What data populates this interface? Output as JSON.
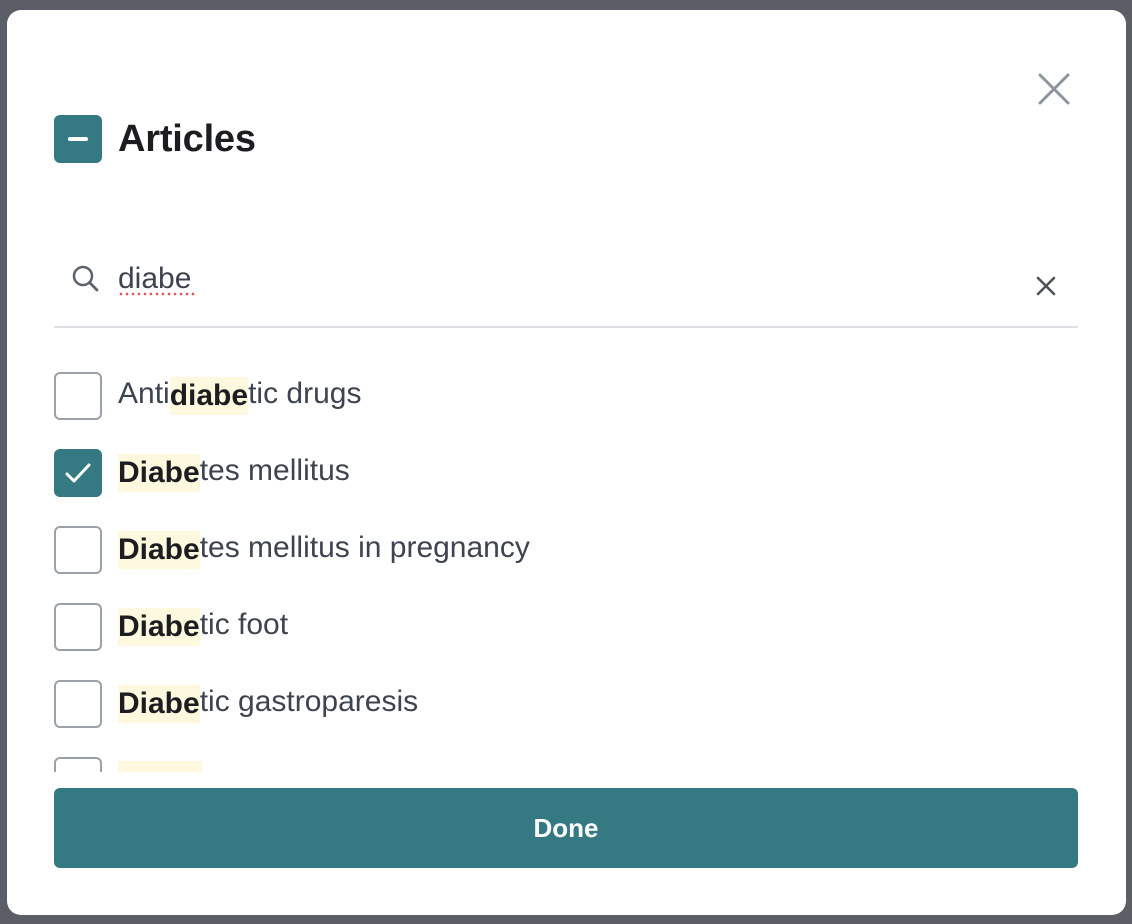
{
  "dialog": {
    "title": "Articles",
    "close_icon": "close-icon"
  },
  "search": {
    "value": "diabe",
    "icon": "search-icon",
    "clear_icon": "clear-icon"
  },
  "items": [
    {
      "before": "Anti",
      "match": "diabe",
      "after": "tic drugs",
      "checked": false
    },
    {
      "before": "",
      "match": "Diabe",
      "after": "tes mellitus",
      "checked": true
    },
    {
      "before": "",
      "match": "Diabe",
      "after": "tes mellitus in pregnancy",
      "checked": false
    },
    {
      "before": "",
      "match": "Diabe",
      "after": "tic foot",
      "checked": false
    },
    {
      "before": "",
      "match": "Diabe",
      "after": "tic gastroparesis",
      "checked": false
    }
  ],
  "footer": {
    "done_label": "Done"
  },
  "colors": {
    "accent": "#357983",
    "highlight": "#fdf8de"
  }
}
